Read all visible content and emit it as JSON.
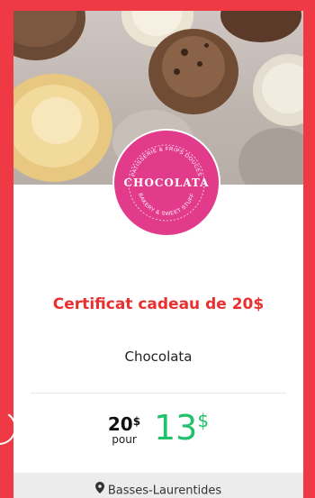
{
  "logo": {
    "word": "CHOCOLATA",
    "arc_top": "PATISSERIE & FRIPS DOUCES",
    "arc_bottom": "BAKERY & SWEET STUFF"
  },
  "offer": {
    "title": "Certificat cadeau de 20$",
    "merchant": "Chocolata",
    "original_price": "20",
    "original_currency": "$",
    "pour_label": "pour",
    "sale_price": "13",
    "sale_currency": "$"
  },
  "location": {
    "icon": "map-pin-icon",
    "label": "Basses-Laurentides"
  },
  "colors": {
    "frame": "#ef3a45",
    "title": "#e8302f",
    "sale_price": "#21c26b",
    "logo_bg": "#e23b8c",
    "location_bar": "#ececec"
  }
}
